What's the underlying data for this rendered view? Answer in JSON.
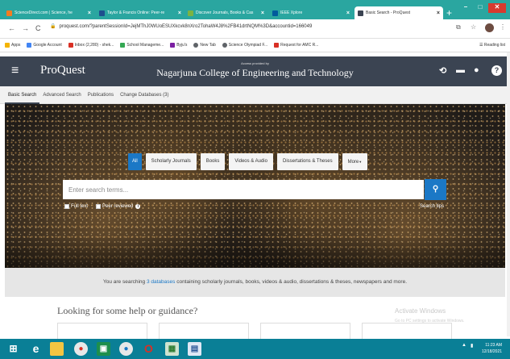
{
  "browser": {
    "tabs": [
      {
        "title": "ScienceDirect.com | Science, he",
        "favicon_color": "#f47c20"
      },
      {
        "title": "Taylor & Francis Online: Peer-re",
        "favicon_color": "#1e4f8e"
      },
      {
        "title": "Discover Journals, Books & Cas",
        "favicon_color": "#7cb342"
      },
      {
        "title": "IEEE Xplore",
        "favicon_color": "#005a9c"
      },
      {
        "title": "Basic Search - ProQuest",
        "favicon_color": "#ffffff",
        "active": true
      }
    ],
    "new_tab": "+",
    "window_controls": {
      "minimize": "–",
      "maximize": "□",
      "close": "✕"
    },
    "nav": {
      "back": "←",
      "forward": "→",
      "reload": "C"
    },
    "url": "proquest.com/?parentSessionId=JejMThJ0WUoESUXkcvk8nXro2TohaW4J8%2FB41drtNQM%3D&accountid=166049",
    "bookmarks": [
      {
        "label": "Apps",
        "icon_color": "#f4b400"
      },
      {
        "label": "Google Account",
        "icon_color": "#4285f4"
      },
      {
        "label": "Inbox (2,280) - shek...",
        "icon_color": "#d93025"
      },
      {
        "label": "School Manageme...",
        "icon_color": "#34a853"
      },
      {
        "label": "Byju's",
        "icon_color": "#7b1fa2"
      },
      {
        "label": "New Tab",
        "icon_color": "#5f6368"
      },
      {
        "label": "Science Olympiad F...",
        "icon_color": "#5f6368"
      },
      {
        "label": "Request for AMC R...",
        "icon_color": "#d93025"
      }
    ],
    "reading_list": "Reading list"
  },
  "header": {
    "logo": "ProQuest",
    "provided_by": "Access provided by",
    "institution": "Nagarjuna College of Engineering and Technology",
    "background_color": "#3b4452"
  },
  "subnav": {
    "items": [
      "Basic Search",
      "Advanced Search",
      "Publications",
      "Change Databases (3)"
    ]
  },
  "search": {
    "source_tabs": [
      "All",
      "Scholarly Journals",
      "Books",
      "Videos & Audio",
      "Dissertations & Theses",
      "More"
    ],
    "placeholder": "Enter search terms...",
    "options": [
      "Full text",
      "Peer reviewed"
    ],
    "tips": "Search tips",
    "accent_color": "#1b78c6"
  },
  "databases": {
    "prefix": "You are searching",
    "link": "3 databases",
    "suffix": "containing scholarly journals, books, videos & audio, dissertations & theses, newspapers and more."
  },
  "help": {
    "title": "Looking for some help or guidance?"
  },
  "watermark": {
    "line1": "Activate Windows",
    "line2": "Go to PC settings to activate Windows."
  },
  "taskbar": {
    "time": "11:23 AM",
    "date": "12/18/2021"
  }
}
